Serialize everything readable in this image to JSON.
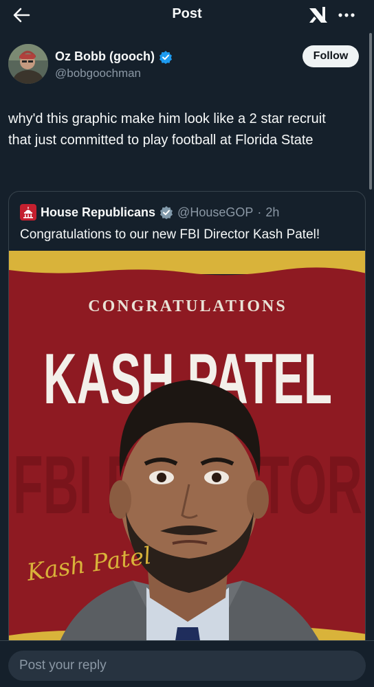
{
  "header": {
    "back_icon": "arrow-left-icon",
    "title": "Post",
    "grok_icon": "xai-grok-icon",
    "more_icon": "more-horizontal-icon"
  },
  "post": {
    "author": {
      "name": "Oz Bobb (gooch)",
      "handle": "@bobgoochman",
      "verified": true
    },
    "follow_label": "Follow",
    "text": "why'd this graphic make him look like a 2 star recruit that just committed to play football at Florida State"
  },
  "quoted_post": {
    "author": {
      "name": "House Republicans",
      "handle": "@HouseGOP",
      "time": "2h",
      "verified": true
    },
    "separator": "·",
    "text": "Congratulations to our new FBI Director Kash Patel!",
    "image": {
      "heading": "CONGRATULATIONS",
      "name_text": "KASH PATEL",
      "background_text": "FBI DIRECTOR",
      "signature": "Kash Patel"
    }
  },
  "reply": {
    "placeholder": "Post your reply"
  },
  "colors": {
    "background": "#15202b",
    "primary_text": "#f7f9f9",
    "secondary_text": "#8b98a5",
    "verified_blue": "#1d9bf0",
    "follow_bg": "#eff3f4",
    "poster_red": "#8e1a22",
    "poster_gold": "#d9b33a"
  }
}
